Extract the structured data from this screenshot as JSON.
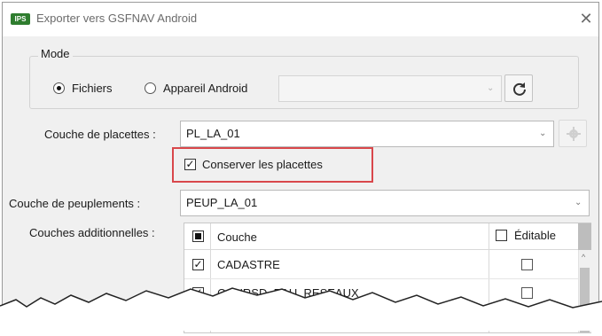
{
  "window": {
    "app_icon": "IPS",
    "title": "Exporter vers GSFNAV Android",
    "close_glyph": "✕"
  },
  "mode": {
    "legend": "Mode",
    "options": [
      {
        "label": "Fichiers",
        "selected": true
      },
      {
        "label": "Appareil Android",
        "selected": false
      }
    ],
    "device_combo_value": "",
    "refresh_icon": "refresh-icon"
  },
  "placettes": {
    "label": "Couche de placettes :",
    "value": "PL_LA_01",
    "keep_checkbox": {
      "label": "Conserver les placettes",
      "checked": true
    }
  },
  "peuplements": {
    "label": "Couche de peuplements :",
    "value": "PEUP_LA_01"
  },
  "additionnelles": {
    "label": "Couches additionnelles :",
    "columns": {
      "layer": "Couche",
      "editable": "Éditable"
    },
    "rows": [
      {
        "name": "CADASTRE",
        "included": true,
        "editable": false
      },
      {
        "name": "COURSD_EAU_RESEAUX",
        "included": true,
        "editable": false
      },
      {
        "name": "",
        "included": true,
        "editable": false
      }
    ]
  },
  "colors": {
    "highlight": "#d9474b",
    "app_icon_bg": "#2f7d2f"
  }
}
